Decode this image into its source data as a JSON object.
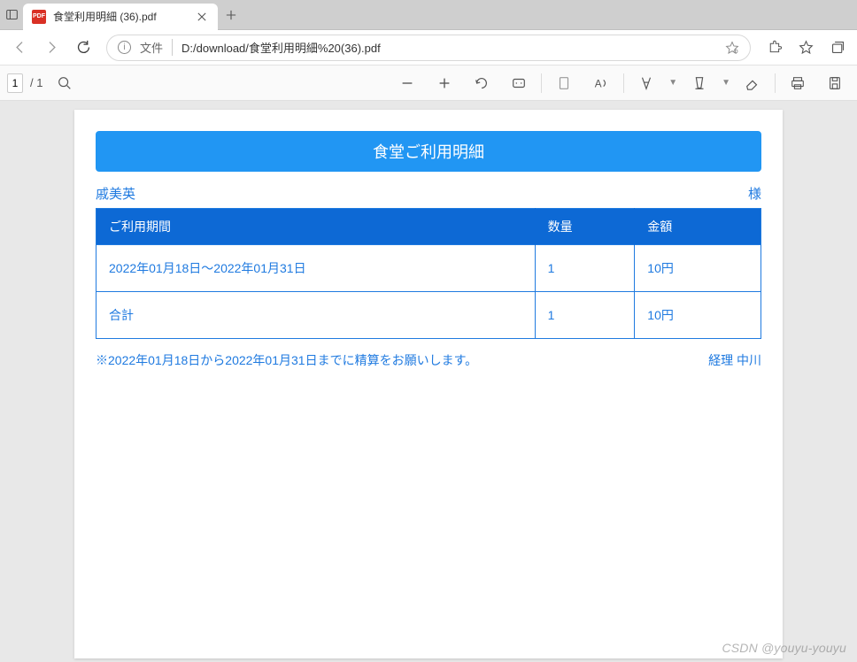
{
  "tab": {
    "title": "食堂利用明細 (36).pdf"
  },
  "address": {
    "file_label": "文件",
    "url": "D:/download/食堂利用明細%20(36).pdf"
  },
  "pdf_toolbar": {
    "page_current": "1",
    "page_total": "/ 1"
  },
  "document": {
    "title": "食堂ご利用明細",
    "name": "戚美英",
    "honorific": "様",
    "headers": {
      "period": "ご利用期間",
      "quantity": "数量",
      "amount": "金額"
    },
    "rows": [
      {
        "period": "2022年01月18日～2022年01月31日",
        "quantity": "1",
        "amount": "10円"
      },
      {
        "period": "合計",
        "quantity": "1",
        "amount": "10円"
      }
    ],
    "note": "※2022年01月18日から2022年01月31日までに精算をお願いします。",
    "signer": "経理 中川"
  },
  "watermark": "CSDN @youyu-youyu"
}
